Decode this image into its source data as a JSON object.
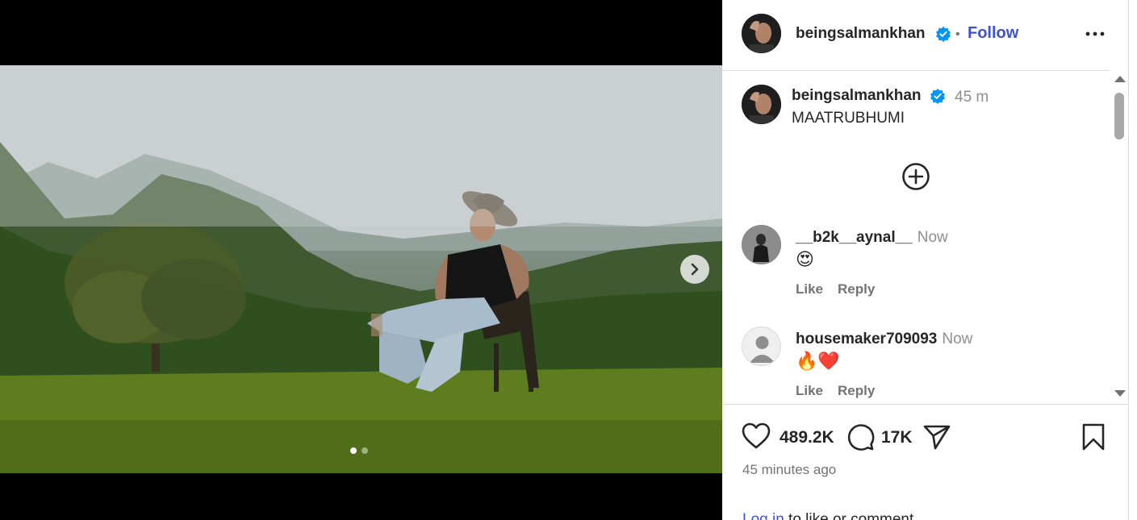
{
  "post": {
    "username": "beingsalmankhan",
    "follow_label": "Follow",
    "separator": "•",
    "caption_time": "45 m",
    "caption_text": "MAATRUBHUMI"
  },
  "carousel": {
    "slide_count": 2,
    "active_index": 0
  },
  "comments": [
    {
      "username": "__b2k__aynal__",
      "time": "Now",
      "text": "😍",
      "like_label": "Like",
      "reply_label": "Reply",
      "avatar": "photo-avatar"
    },
    {
      "username": "housemaker709093",
      "time": "Now",
      "text": "🔥❤️",
      "like_label": "Like",
      "reply_label": "Reply",
      "avatar": "default-avatar"
    }
  ],
  "stats": {
    "likes": "489.2K",
    "comments": "17K",
    "posted_ago": "45 minutes ago"
  },
  "footer": {
    "login_link": "Log in",
    "login_suffix": " to like or comment."
  },
  "colors": {
    "link": "#3f51d4",
    "verified": "#0095f6",
    "muted": "#737373"
  }
}
